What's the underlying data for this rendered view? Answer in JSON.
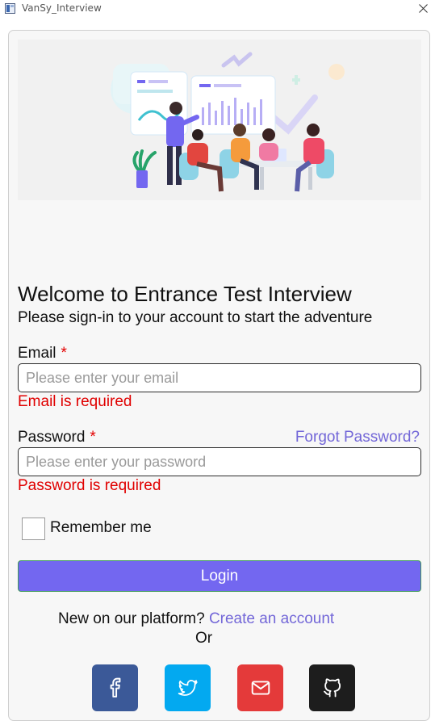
{
  "window": {
    "title": "VanSy_Interview"
  },
  "heading": {
    "title": "Welcome to Entrance Test Interview",
    "subtitle": "Please sign-in to your account to start the adventure"
  },
  "form": {
    "email": {
      "label": "Email",
      "required_mark": "*",
      "placeholder": "Please enter your email",
      "value": "",
      "error": "Email is required"
    },
    "password": {
      "label": "Password",
      "required_mark": "*",
      "placeholder": "Please enter your password",
      "value": "",
      "error": "Password is required"
    },
    "forgot_password": "Forgot Password?",
    "remember_me": {
      "label": "Remember me",
      "checked": false
    },
    "login_label": "Login"
  },
  "signup": {
    "prompt": "New on our platform?",
    "link": "Create an account",
    "or": "Or"
  },
  "social": [
    {
      "name": "facebook",
      "icon": "facebook-icon",
      "color": "#3b5998"
    },
    {
      "name": "twitter",
      "icon": "twitter-icon",
      "color": "#03a9f0"
    },
    {
      "name": "gmail",
      "icon": "mail-icon",
      "color": "#e43a3a"
    },
    {
      "name": "github",
      "icon": "github-icon",
      "color": "#1d1d1d"
    }
  ],
  "colors": {
    "accent": "#7367f0",
    "error": "#e00000",
    "link": "#7367d8"
  }
}
